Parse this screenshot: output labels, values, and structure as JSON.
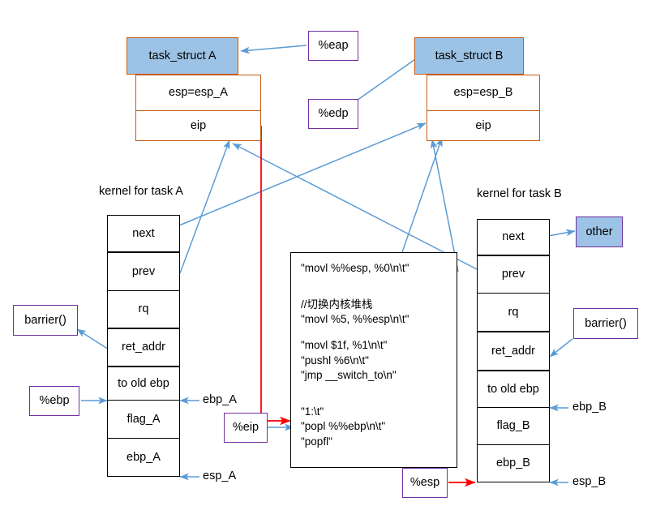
{
  "diagram": {
    "title_hidden": "Linux context switch: task_struct and kernel stacks",
    "colors": {
      "task_struct_fill": "#9CC3E5",
      "task_struct_border": "#C55A11",
      "label_border": "#7030A0",
      "stack_border": "#000000",
      "blue_arrow": "#5B9BD5",
      "red_arrow": "#FF0000"
    }
  },
  "task_struct_a": {
    "header": "task_struct A",
    "rows": [
      "esp=esp_A",
      "eip"
    ]
  },
  "task_struct_b": {
    "header": "task_struct B",
    "rows": [
      "esp=esp_B",
      "eip"
    ]
  },
  "captions": {
    "kernel_a": "kernel for task A",
    "kernel_b": "kernel for task B"
  },
  "stack_a": {
    "rows": [
      "next",
      "prev",
      "rq",
      "ret_addr",
      "to old ebp",
      "flag_A",
      "ebp_A"
    ],
    "pointer_ebp": "ebp_A",
    "pointer_esp": "esp_A"
  },
  "stack_b": {
    "rows": [
      "next",
      "prev",
      "rq",
      "ret_addr",
      "to old ebp",
      "flag_B",
      "ebp_B"
    ],
    "pointer_ebp": "ebp_B",
    "pointer_esp": "esp_B"
  },
  "registers": {
    "eap": "%eap",
    "edp": "%edp",
    "ebp": "%ebp",
    "eip": "%eip",
    "esp": "%esp"
  },
  "labels": {
    "barrier_left": "barrier()",
    "barrier_right": "barrier()",
    "other": "other"
  },
  "code": {
    "lines": [
      "\"movl %%esp, %0\\n\\t\"",
      "",
      "",
      "//切换内核堆栈",
      "\"movl %5, %%esp\\n\\t\"",
      "",
      "\"movl $1f, %1\\n\\t\"",
      "\"pushl %6\\n\\t\"",
      "\"jmp __switch_to\\n\"",
      "",
      "",
      "\"1:\\t\"",
      "\"popl %%ebp\\n\\t\"",
      "\"popfl\""
    ]
  }
}
